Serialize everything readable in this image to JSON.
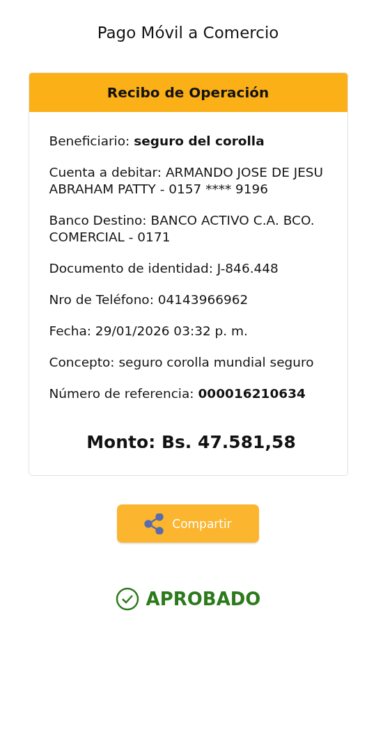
{
  "title": "Pago Móvil a Comercio",
  "receipt": {
    "header": "Recibo de Operación",
    "fields": [
      "Beneficiario: **seguro del corolla**",
      "Cuenta a debitar: ARMANDO JOSE DE JESU ABRAHAM PATTY - 0157 **** 9196",
      "Banco Destino: BANCO ACTIVO C.A. BCO. COMERCIAL - 0171",
      "Documento de identidad: J-846.448",
      "Nro de Teléfono: 04143966962",
      "Fecha: 29/01/2026 03:32 p. m.",
      "Concepto: seguro corolla mundial seguro",
      "Número de referencia: **000016210634**"
    ],
    "amount": "Monto: Bs. 47.581,58"
  },
  "share_button": {
    "label": "Compartir"
  },
  "status": {
    "label": "APROBADO"
  }
}
